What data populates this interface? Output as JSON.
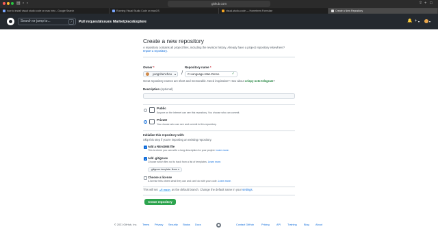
{
  "browser": {
    "url": "github.com",
    "tabs": [
      {
        "label": "how to install visual studio code on mac intro - Google Search",
        "active": false
      },
      {
        "label": "Running Visual Studio Code on macOS",
        "active": false
      },
      {
        "label": "visual-studio-code — Homebrew Formulae",
        "active": false
      },
      {
        "label": "Create a New Repository",
        "active": true
      }
    ]
  },
  "header": {
    "search_placeholder": "Search or jump to...",
    "search_hotkey": "/",
    "nav": [
      "Pull requests",
      "Issues",
      "Marketplace",
      "Explore"
    ],
    "bell_icon": "bell-icon",
    "plus_icon": "plus-icon",
    "plus_caret": "▾",
    "avatar_caret": "▾"
  },
  "page": {
    "title": "Create a new repository",
    "subtitle": "A repository contains all project files, including the revision history. Already have a project repository elsewhere?",
    "import_link": "Import a repository."
  },
  "form": {
    "owner_label": "Owner",
    "required_mark": "*",
    "owner_value": "yungchenchou",
    "owner_caret": "▾",
    "slash": "/",
    "repo_label": "Repository name",
    "repo_value": "C-Language-Man-Demo",
    "repo_check": "✓",
    "hint_text": "Great repository names are short and memorable. Need inspiration? How about",
    "suggestion": "crispy-octo-telegram",
    "hint_end": "?",
    "description_label": "Description",
    "description_optional": "(optional)",
    "description_value": "",
    "visibility": {
      "selected": "Private",
      "options": [
        {
          "title": "Public",
          "desc": "Anyone on the internet can see this repository. You choose who can commit."
        },
        {
          "title": "Private",
          "desc": "You choose who can see and commit to this repository."
        }
      ]
    },
    "init_title": "Initialize this repository with:",
    "init_desc": "Skip this step if you're importing an existing repository.",
    "readme": {
      "label": "Add a README file",
      "checked": true,
      "desc": "This is where you can write a long description for your project.",
      "link": "Learn more."
    },
    "gitignore": {
      "label": "Add .gitignore",
      "checked": true,
      "desc": "Choose which files not to track from a list of templates.",
      "link": "Learn more.",
      "template_label": ".gitignore template: None ▾"
    },
    "license": {
      "label": "Choose a license",
      "checked": false,
      "desc": "A license tells others what they can and can't do with your code.",
      "link": "Learn more."
    },
    "branch_prefix": "This will set",
    "branch_name": "main",
    "branch_suffix": "as the default branch. Change the default name in your",
    "branch_settings_link": "settings",
    "branch_end": ".",
    "create_button": "Create repository"
  },
  "footer": {
    "copyright": "© 2021 GitHub, Inc.",
    "links_left": [
      "Terms",
      "Privacy",
      "Security",
      "Status",
      "Docs"
    ],
    "links_right": [
      "Contact GitHub",
      "Pricing",
      "API",
      "Training",
      "Blog",
      "About"
    ]
  },
  "colors": {
    "accent": "#0969da",
    "success": "#2da44e",
    "header_bg": "#24292f"
  }
}
